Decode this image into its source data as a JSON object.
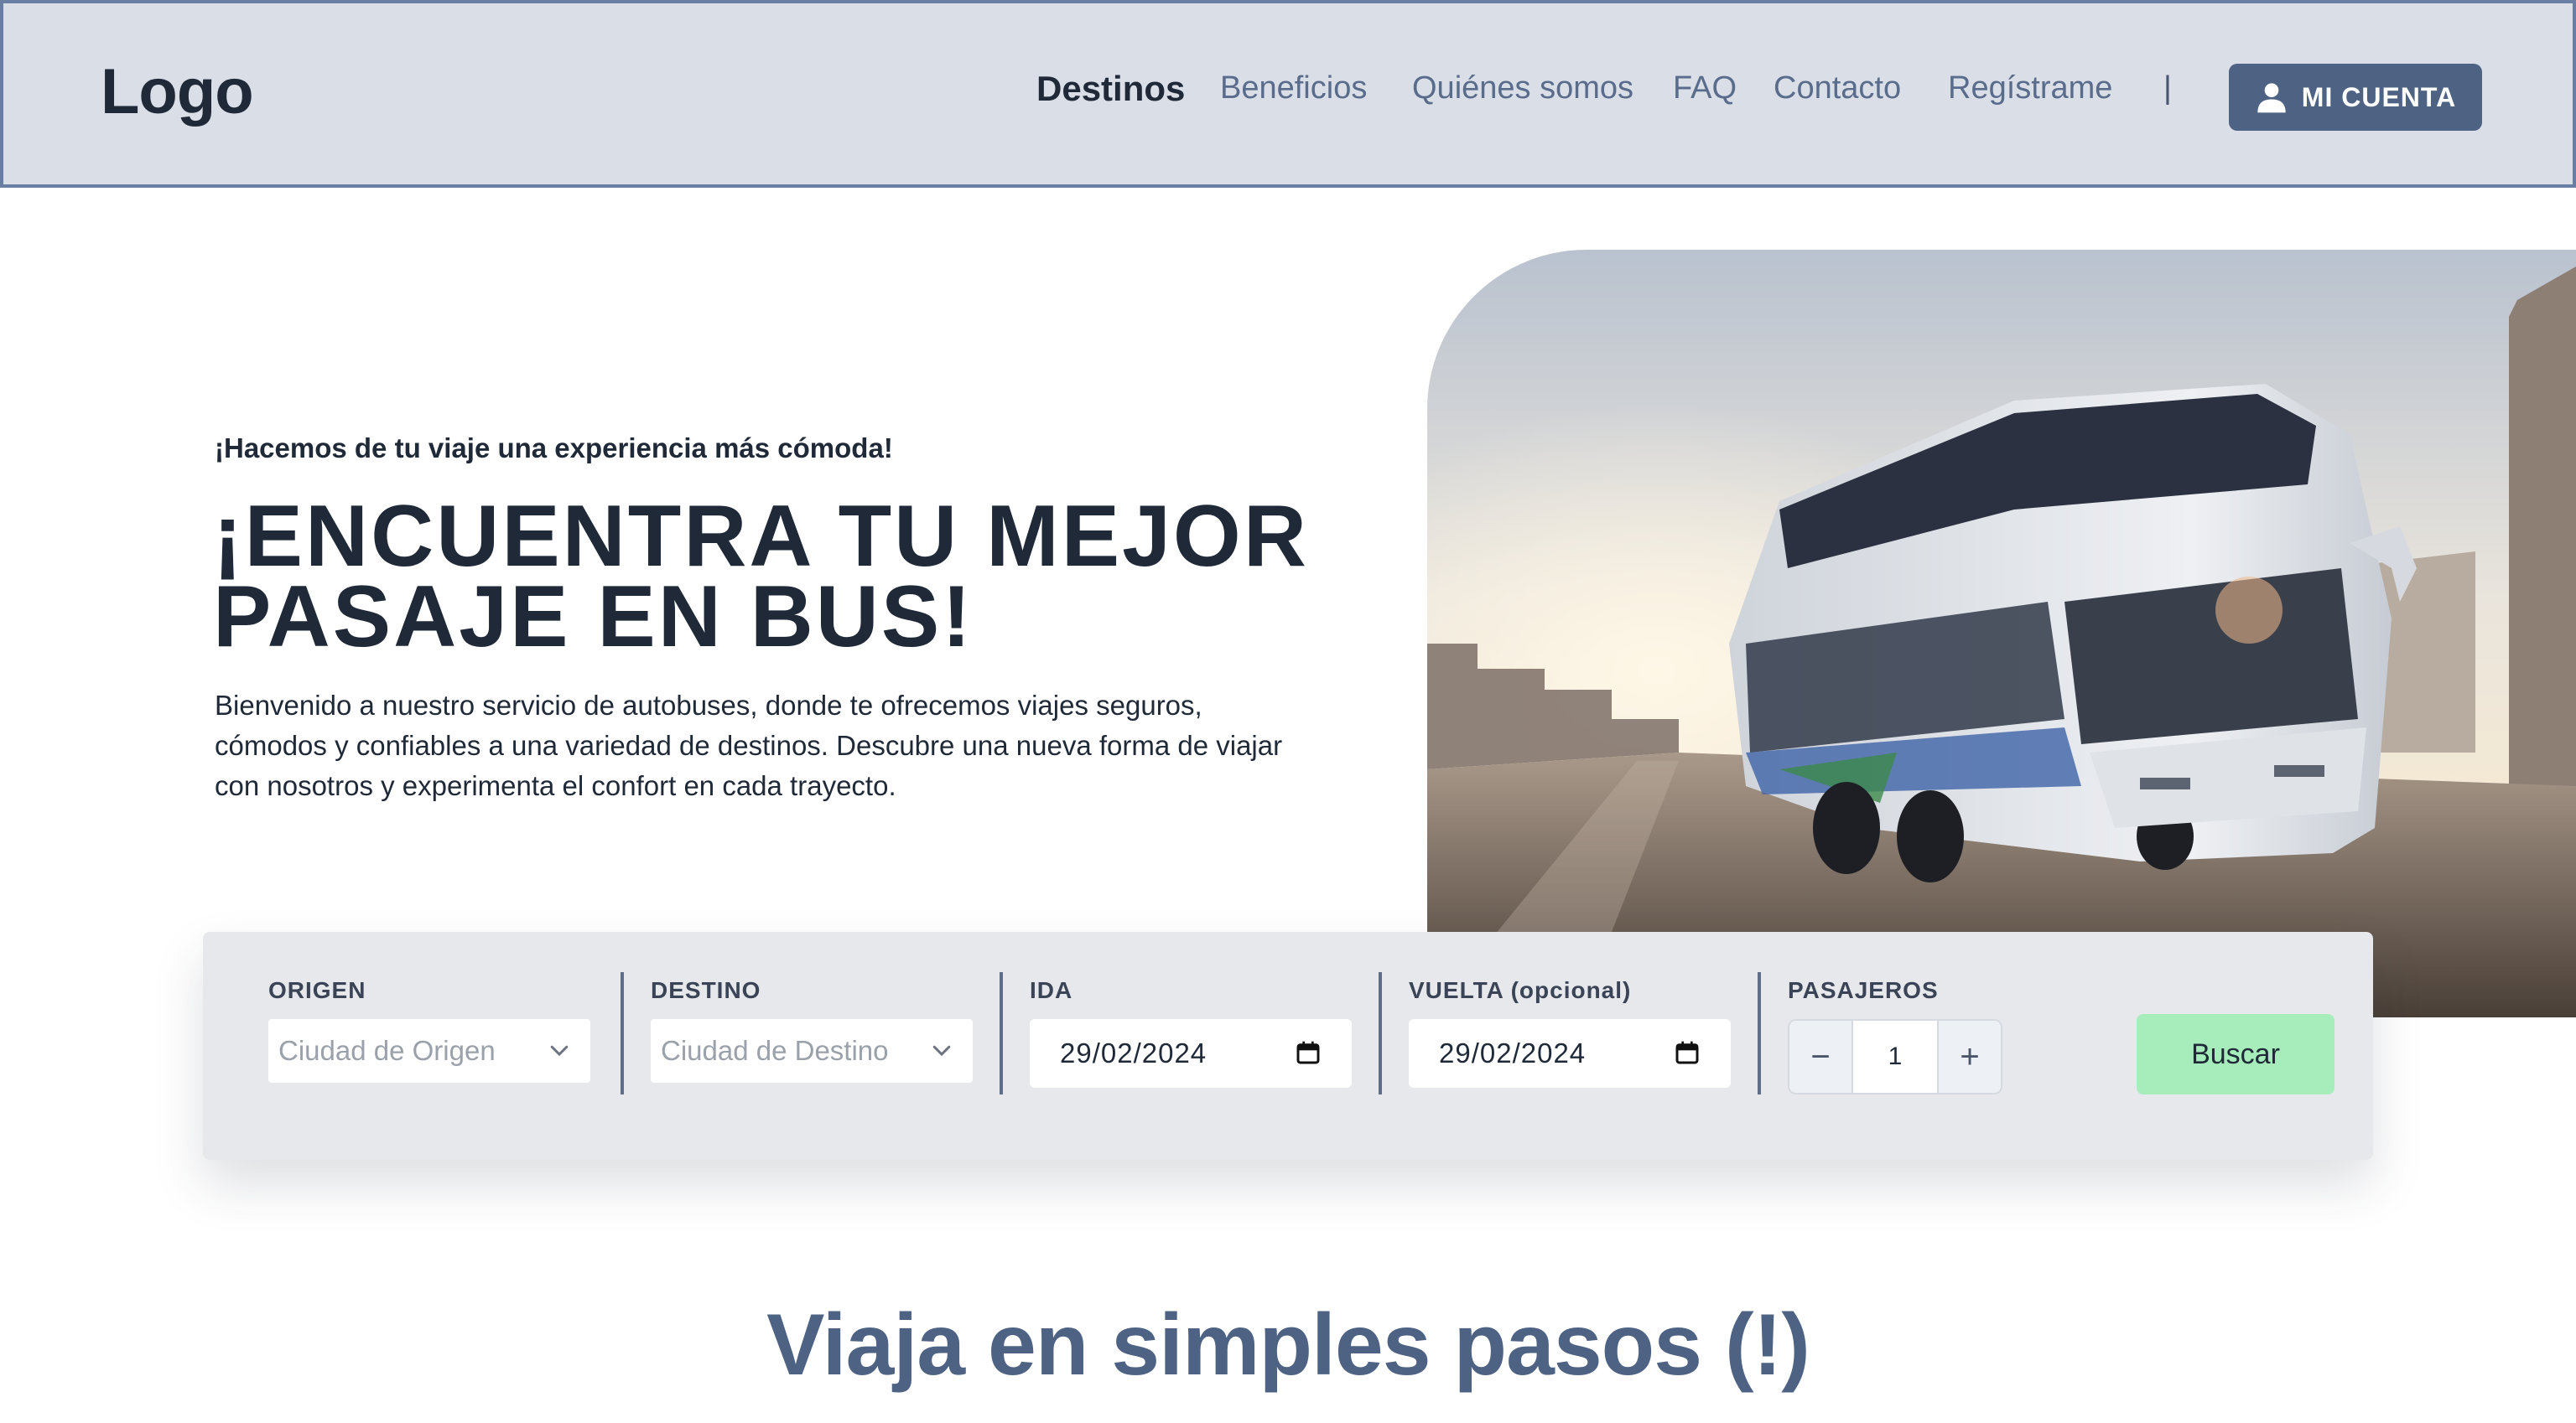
{
  "navbar": {
    "logo": "Logo",
    "links": [
      "Destinos",
      "Beneficios",
      "Quiénes somos",
      "FAQ",
      "Contacto",
      "Regístrame"
    ],
    "active_link": "Destinos",
    "separator": "|",
    "account_button": "MI CUENTA",
    "account_icon": "user-icon"
  },
  "hero": {
    "tagline": "¡Hacemos de tu viaje una experiencia más cómoda!",
    "title_line1": "¡ENCUENTRA TU MEJOR",
    "title_line2": "PASAJE EN BUS!",
    "description": "Bienvenido a nuestro servicio de autobuses, donde te ofrecemos viajes seguros, cómodos y confiables a una variedad de destinos. Descubre una nueva forma de viajar con nosotros y experimenta el confort en cada trayecto."
  },
  "search": {
    "origin_label": "ORIGEN",
    "origin_placeholder": "Ciudad de Origen",
    "destination_label": "DESTINO",
    "destination_placeholder": "Ciudad de Destino",
    "departure_label": "IDA",
    "departure_value": "29/02/2024",
    "return_label": "VUELTA (opcional)",
    "return_value": "29/02/2024",
    "passengers_label": "PASAJEROS",
    "passengers_value": "1",
    "minus_symbol": "−",
    "plus_symbol": "+",
    "search_button": "Buscar"
  },
  "section": {
    "title": "Viaja en simples pasos (!)"
  },
  "colors": {
    "navbar_bg": "#d9dee7",
    "accent": "#4e6384",
    "search_button_bg": "#a6edbb",
    "text_dark": "#1f2937"
  }
}
